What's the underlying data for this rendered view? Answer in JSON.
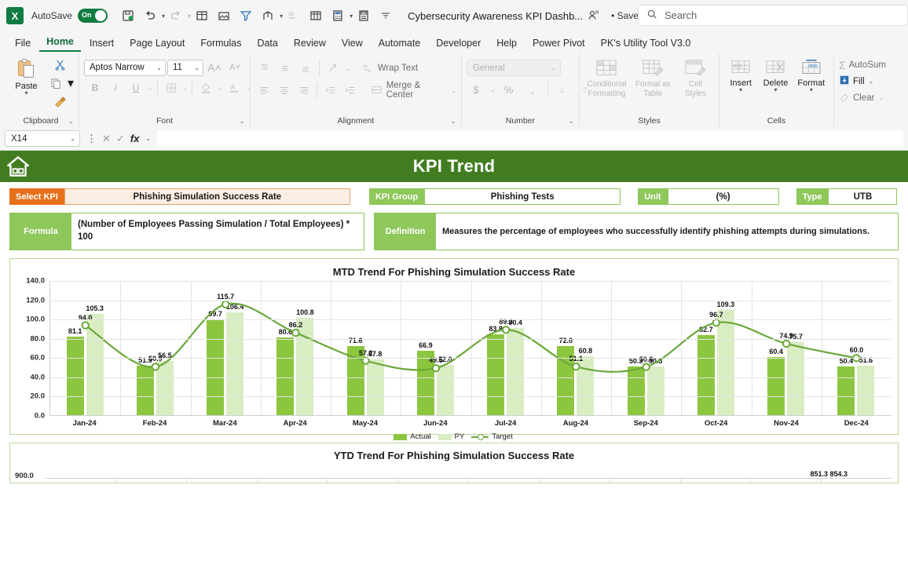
{
  "titlebar": {
    "app_initial": "X",
    "autosave_label": "AutoSave",
    "autosave_state": "On",
    "document_title": "Cybersecurity Awareness KPI Dashb...",
    "saved_status": "• Saved",
    "search_placeholder": "Search"
  },
  "tabs": [
    {
      "label": "File",
      "active": false
    },
    {
      "label": "Home",
      "active": true
    },
    {
      "label": "Insert",
      "active": false
    },
    {
      "label": "Page Layout",
      "active": false
    },
    {
      "label": "Formulas",
      "active": false
    },
    {
      "label": "Data",
      "active": false
    },
    {
      "label": "Review",
      "active": false
    },
    {
      "label": "View",
      "active": false
    },
    {
      "label": "Automate",
      "active": false
    },
    {
      "label": "Developer",
      "active": false
    },
    {
      "label": "Help",
      "active": false
    },
    {
      "label": "Power Pivot",
      "active": false
    },
    {
      "label": "PK's Utility Tool V3.0",
      "active": false
    }
  ],
  "ribbon": {
    "clipboard": {
      "group": "Clipboard",
      "paste": "Paste"
    },
    "font": {
      "group": "Font",
      "family": "Aptos Narrow",
      "size": "11",
      "bold": "B",
      "italic": "I",
      "underline": "U"
    },
    "alignment": {
      "group": "Alignment",
      "wrap_text": "Wrap Text",
      "merge_center": "Merge & Center"
    },
    "number": {
      "group": "Number",
      "format": "General",
      "currency": "$",
      "percent": "%",
      "comma": " ,"
    },
    "styles": {
      "group": "Styles",
      "conditional": "Conditional Formatting",
      "table": "Format as Table",
      "cell": "Cell Styles"
    },
    "cells": {
      "group": "Cells",
      "insert": "Insert",
      "delete": "Delete",
      "format": "Format"
    },
    "editing": {
      "autosum": "AutoSum",
      "fill": "Fill",
      "clear": "Clear"
    }
  },
  "formula_bar": {
    "name_box": "X14",
    "formula": ""
  },
  "dashboard": {
    "banner_title": "KPI Trend",
    "select_kpi_label": "Select KPI",
    "select_kpi_value": "Phishing Simulation Success Rate",
    "kpi_group_label": "KPI Group",
    "kpi_group_value": "Phishing Tests",
    "unit_label": "Unit",
    "unit_value": "(%)",
    "type_label": "Type",
    "type_value": "UTB",
    "formula_label": "Formula",
    "formula_value": "(Number of Employees Passing Simulation / Total Employees) * 100",
    "definition_label": "Definition",
    "definition_value": "Measures the percentage of employees who successfully identify phishing attempts during simulations.",
    "colors": {
      "banner": "#417d20",
      "accent_orange": "#e8701a",
      "accent_green": "#8ec75a",
      "actual": "#8cc63f",
      "py": "#d9edc2",
      "target_line": "#6aa83a"
    }
  },
  "ytd_card": {
    "title": "YTD Trend For Phishing Simulation Success Rate",
    "y_top": "900.0",
    "overlap_label": "851.3 854.3"
  },
  "chart_data": {
    "type": "bar",
    "title": "MTD Trend For Phishing Simulation Success Rate",
    "xlabel": "",
    "ylabel": "",
    "ylim": [
      0,
      140
    ],
    "yticks": [
      "0.0",
      "20.0",
      "40.0",
      "60.0",
      "80.0",
      "100.0",
      "120.0",
      "140.0"
    ],
    "grid": true,
    "legend_position": "bottom",
    "categories": [
      "Jan-24",
      "Feb-24",
      "Mar-24",
      "Apr-24",
      "May-24",
      "Jun-24",
      "Jul-24",
      "Aug-24",
      "Sep-24",
      "Oct-24",
      "Nov-24",
      "Dec-24"
    ],
    "series": [
      {
        "name": "Actual",
        "type": "bar",
        "values": [
          81.1,
          51.5,
          99.7,
          80.6,
          71.6,
          66.9,
          83.8,
          72.0,
          50.3,
          82.7,
          60.4,
          50.4
        ]
      },
      {
        "name": "PY",
        "type": "bar",
        "values": [
          105.3,
          56.5,
          106.4,
          100.8,
          57.8,
          52.0,
          90.4,
          60.8,
          50.3,
          109.3,
          75.7,
          51.6
        ]
      },
      {
        "name": "Target",
        "type": "line",
        "values": [
          94.0,
          50.9,
          115.7,
          86.2,
          57.2,
          49.5,
          89.3,
          51.1,
          50.8,
          96.7,
          74.9,
          60.0
        ]
      }
    ]
  }
}
